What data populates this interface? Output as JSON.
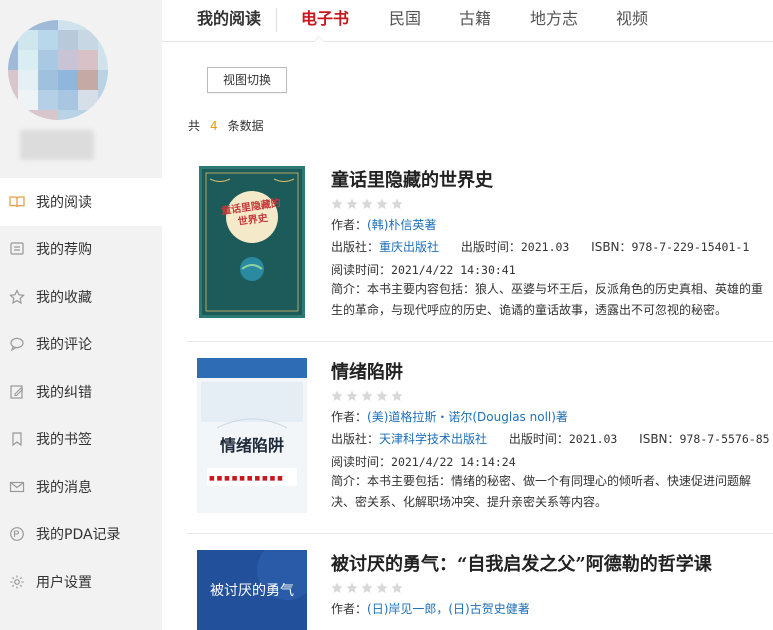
{
  "tabs": {
    "home": "我的阅读",
    "items": [
      "电子书",
      "民国",
      "古籍",
      "地方志",
      "视频"
    ]
  },
  "sidebar": {
    "items": [
      {
        "label": "我的阅读",
        "icon": "book-open-icon"
      },
      {
        "label": "我的荐购",
        "icon": "recommend-icon"
      },
      {
        "label": "我的收藏",
        "icon": "star-icon"
      },
      {
        "label": "我的评论",
        "icon": "comment-icon"
      },
      {
        "label": "我的纠错",
        "icon": "edit-icon"
      },
      {
        "label": "我的书签",
        "icon": "bookmark-icon"
      },
      {
        "label": "我的消息",
        "icon": "mail-icon"
      },
      {
        "label": "我的PDA记录",
        "icon": "pda-icon"
      },
      {
        "label": "用户设置",
        "icon": "gear-icon"
      }
    ]
  },
  "toolbar": {
    "view_toggle": "视图切换"
  },
  "summary": {
    "prefix": "共",
    "count": "4",
    "suffix": "条数据"
  },
  "books": [
    {
      "title": "童话里隐藏的世界史",
      "cover_title": "童话里隐藏的世界史",
      "author_label": "作者：",
      "author": "(韩)朴信英著",
      "publisher_label": "出版社：",
      "publisher": "重庆出版社",
      "date_label": "出版时间：",
      "date": "2021.03",
      "isbn_label": "ISBN：",
      "isbn": "978-7-229-15401-1",
      "read_label": "阅读时间：",
      "read_time": "2021/4/22 14:30:41",
      "summary": "简介：本书主要内容包括：狼人、巫婆与坏王后，反派角色的历史真相、英雄的重生的革命，与现代呼应的历史、诡谲的童话故事，透露出不可忽视的秘密。"
    },
    {
      "title": "情绪陷阱",
      "cover_title": "情绪陷阱",
      "author_label": "作者：",
      "author": "(美)道格拉斯・诺尔(Douglas noll)著",
      "publisher_label": "出版社：",
      "publisher": "天津科学技术出版社",
      "date_label": "出版时间：",
      "date": "2021.03",
      "isbn_label": "ISBN：",
      "isbn": "978-7-5576-85",
      "read_label": "阅读时间：",
      "read_time": "2021/4/22 14:14:24",
      "summary": "简介：本书主要包括：情绪的秘密、做一个有同理心的倾听者、快速促进问题解决、密关系、化解职场冲突、提升亲密关系等内容。"
    },
    {
      "title": "被讨厌的勇气：“自我启发之父”阿德勒的哲学课",
      "cover_title": "被讨厌的勇气",
      "author_label": "作者：",
      "author": "(日)岸见一郎，(日)古贺史健著"
    }
  ],
  "colors": {
    "accent": "#c8161d",
    "link": "#1e6fb8",
    "count": "#f39800",
    "sidebar_bg": "#f2f2f2"
  }
}
